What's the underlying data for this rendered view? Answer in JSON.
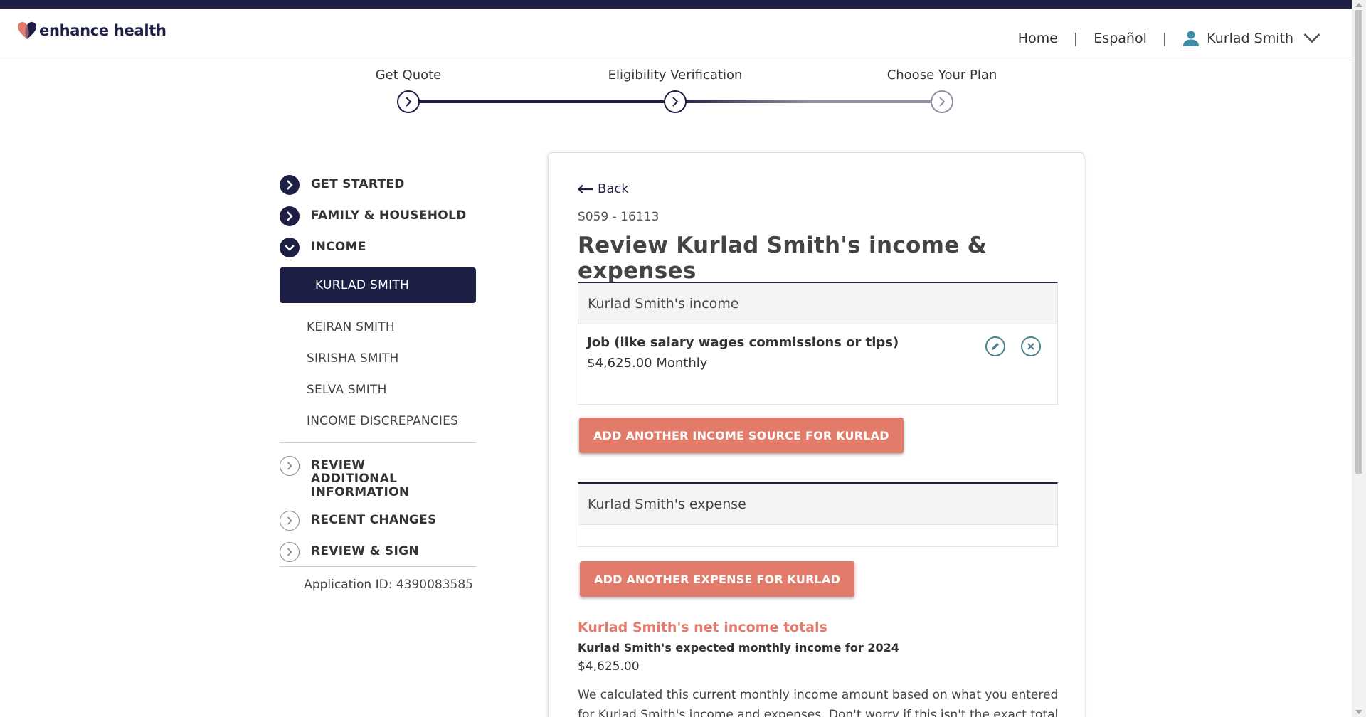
{
  "header": {
    "logo_text": "enhance health",
    "nav_home": "Home",
    "nav_separator": "|",
    "nav_language": "Español",
    "user_name": "Kurlad Smith"
  },
  "stepper": {
    "steps": [
      {
        "label": "Get Quote",
        "state": "complete"
      },
      {
        "label": "Eligibility Verification",
        "state": "current"
      },
      {
        "label": "Choose Your Plan",
        "state": "upcoming"
      }
    ]
  },
  "sidebar": {
    "sections": [
      {
        "label": "GET STARTED",
        "icon": "chevron-right-icon"
      },
      {
        "label": "FAMILY & HOUSEHOLD",
        "icon": "chevron-right-icon"
      },
      {
        "label": "INCOME",
        "icon": "chevron-down-icon"
      }
    ],
    "income_people": [
      {
        "label": "KURLAD SMITH",
        "active": true
      },
      {
        "label": "KEIRAN SMITH"
      },
      {
        "label": "SIRISHA SMITH"
      },
      {
        "label": "SELVA SMITH"
      },
      {
        "label": "INCOME DISCREPANCIES"
      }
    ],
    "later_sections": [
      {
        "label": "REVIEW ADDITIONAL INFORMATION"
      },
      {
        "label": "RECENT CHANGES"
      },
      {
        "label": "REVIEW & SIGN"
      }
    ],
    "application_id": "Application ID: 4390083585"
  },
  "main": {
    "back_label": "Back",
    "code": "S059 - 16113",
    "title": "Review Kurlad Smith's income & expenses",
    "income_panel": {
      "heading": "Kurlad Smith's income",
      "items": [
        {
          "type": "Job (like salary wages commissions or tips)",
          "amount": "$4,625.00 Monthly"
        }
      ]
    },
    "add_income_button": "ADD ANOTHER INCOME SOURCE FOR KURLAD",
    "expense_panel": {
      "heading": "Kurlad Smith's expense"
    },
    "add_expense_button": "ADD ANOTHER EXPENSE FOR KURLAD",
    "totals": {
      "title": "Kurlad Smith's net income totals",
      "subtitle": "Kurlad Smith's expected monthly income for 2024",
      "amount": "$4,625.00",
      "note": "We calculated this current monthly income amount based on what you entered for Kurlad Smith's income and expenses. Don't worry if this isn't the exact total - we just"
    }
  },
  "colors": {
    "navy": "#1e1f45",
    "coral": "#e27b6a",
    "teal_icon": "#4a7f8c"
  }
}
